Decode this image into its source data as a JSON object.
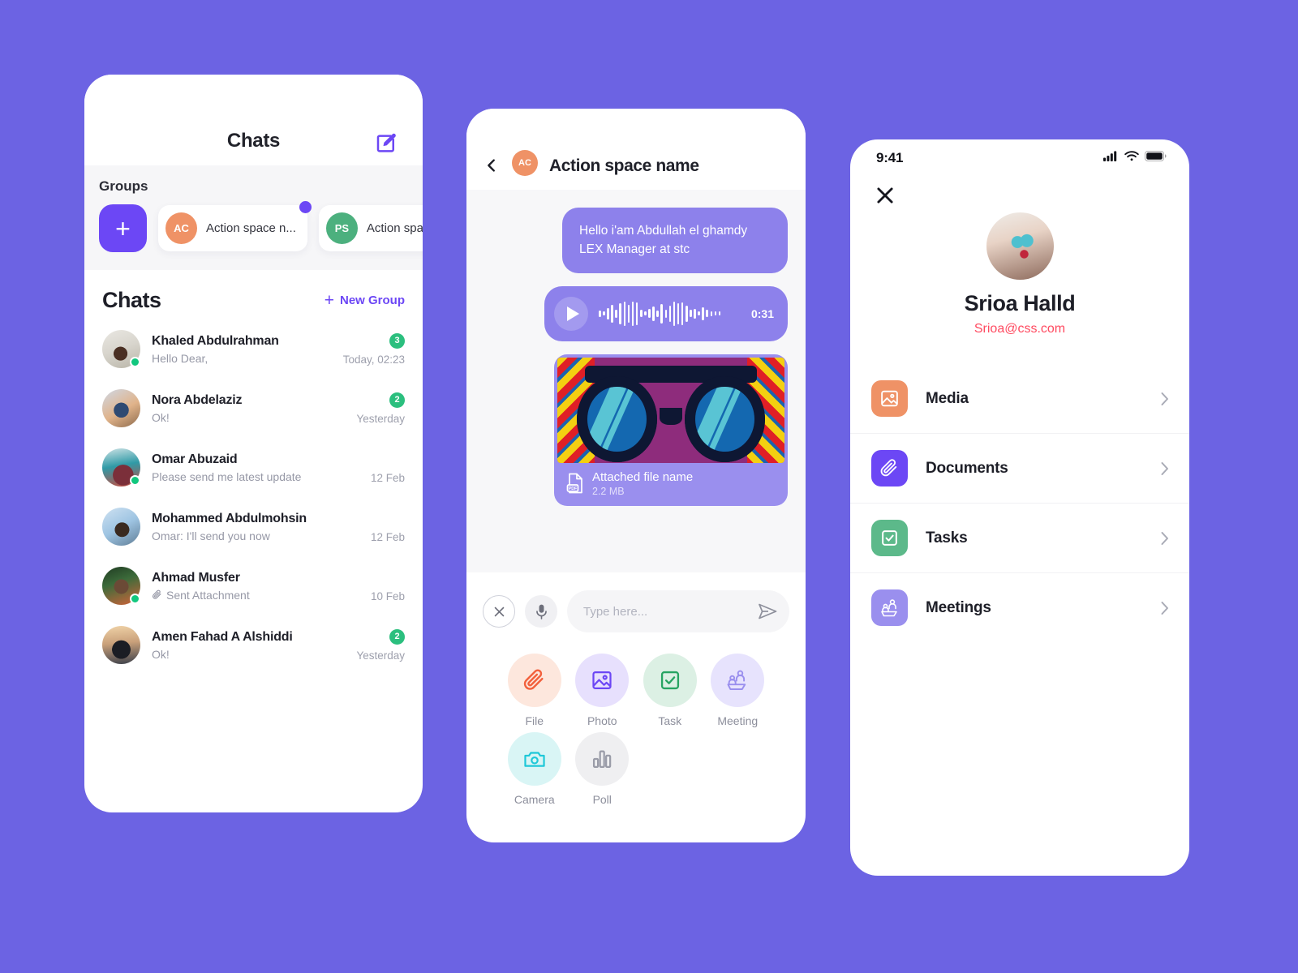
{
  "theme": {
    "page_background": "#6C63E3",
    "accent_purple": "#6C47F5",
    "bubble_purple": "#8D81EB",
    "green_badge": "#2BBF7E",
    "email_red": "#FF4A60",
    "orange": "#EF9266"
  },
  "chats_screen": {
    "header": {
      "title": "Chats",
      "edit_icon": "compose-edit-icon"
    },
    "groups": {
      "section_title": "Groups",
      "add_button_label": "+",
      "items": [
        {
          "initials": "AC",
          "name": "Action space n...",
          "avatar_color": "#EF9266",
          "has_dot": true
        },
        {
          "initials": "PS",
          "name": "Action space n",
          "avatar_color": "#4CB07E",
          "has_dot": false
        }
      ]
    },
    "chats": {
      "section_title": "Chats",
      "new_group_label": "New Group",
      "rows": [
        {
          "name": "Khaled Abdulrahman",
          "snippet": "Hello Dear,",
          "time": "Today, 02:23",
          "badge": "3",
          "online": true,
          "attachment": false,
          "photo": "ph1"
        },
        {
          "name": "Nora Abdelaziz",
          "snippet": "Ok!",
          "time": "Yesterday",
          "badge": "2",
          "online": false,
          "attachment": false,
          "photo": "ph2"
        },
        {
          "name": "Omar Abuzaid",
          "snippet": "Please send me latest update",
          "time": "12 Feb",
          "badge": "",
          "online": true,
          "attachment": false,
          "photo": "ph3"
        },
        {
          "name": "Mohammed Abdulmohsin",
          "snippet": "Omar: I'll send you now",
          "time": "12 Feb",
          "badge": "",
          "online": false,
          "attachment": false,
          "photo": "ph4"
        },
        {
          "name": "Ahmad Musfer",
          "snippet": "Sent Attachment",
          "time": "10 Feb",
          "badge": "",
          "online": true,
          "attachment": true,
          "photo": "ph5"
        },
        {
          "name": "Amen Fahad A Alshiddi",
          "snippet": "Ok!",
          "time": "Yesterday",
          "badge": "2",
          "online": false,
          "attachment": false,
          "photo": "ph6"
        }
      ]
    }
  },
  "conversation_screen": {
    "header": {
      "back_icon": "chevron-left-icon",
      "avatar_initials": "AC",
      "title": "Action space name"
    },
    "messages": {
      "text_message": "Hello i'am Abdullah el ghamdy LEX Manager at stc",
      "voice_note": {
        "duration": "0:31",
        "play_icon": "play-icon"
      },
      "file_attachment": {
        "name": "Attached file name",
        "size": "2.2 MB",
        "type": "PDF"
      }
    },
    "composer": {
      "close_icon": "close-circle-icon",
      "mic_icon": "microphone-icon",
      "placeholder": "Type here...",
      "value": "",
      "send_icon": "send-icon"
    },
    "actions": [
      {
        "label": "File",
        "icon": "paperclip-icon",
        "bg": "#FDE7DD",
        "fg": "#F2603C"
      },
      {
        "label": "Photo",
        "icon": "image-icon",
        "bg": "#E7E0FD",
        "fg": "#6C47F5"
      },
      {
        "label": "Task",
        "icon": "checkbox-icon",
        "bg": "#DCF0E4",
        "fg": "#27A462"
      },
      {
        "label": "Meeting",
        "icon": "meeting-icon",
        "bg": "#E7E3FD",
        "fg": "#9A8FEE"
      },
      {
        "label": "Camera",
        "icon": "camera-icon",
        "bg": "#D9F5F5",
        "fg": "#1EC8D8"
      },
      {
        "label": "Poll",
        "icon": "poll-icon",
        "bg": "#EFEFF1",
        "fg": "#9A9CA8"
      }
    ]
  },
  "profile_screen": {
    "status_bar": {
      "time": "9:41",
      "cellular_icon": "cellular-signal-icon",
      "wifi_icon": "wifi-icon",
      "battery_icon": "battery-full-icon"
    },
    "close_icon": "close-x-icon",
    "name": "Srioa Halld",
    "email": "Srioa@css.com",
    "items": [
      {
        "label": "Media",
        "icon": "media-image-icon",
        "bg": "#EF9266",
        "chevron": "chevron-right-icon"
      },
      {
        "label": "Documents",
        "icon": "paperclip-icon",
        "bg": "#6C47F5",
        "chevron": "chevron-right-icon"
      },
      {
        "label": "Tasks",
        "icon": "checkbox-icon",
        "bg": "#5CB98A",
        "chevron": "chevron-right-icon"
      },
      {
        "label": "Meetings",
        "icon": "meeting-icon",
        "bg": "#9A8FEE",
        "chevron": "chevron-right-icon"
      }
    ]
  }
}
